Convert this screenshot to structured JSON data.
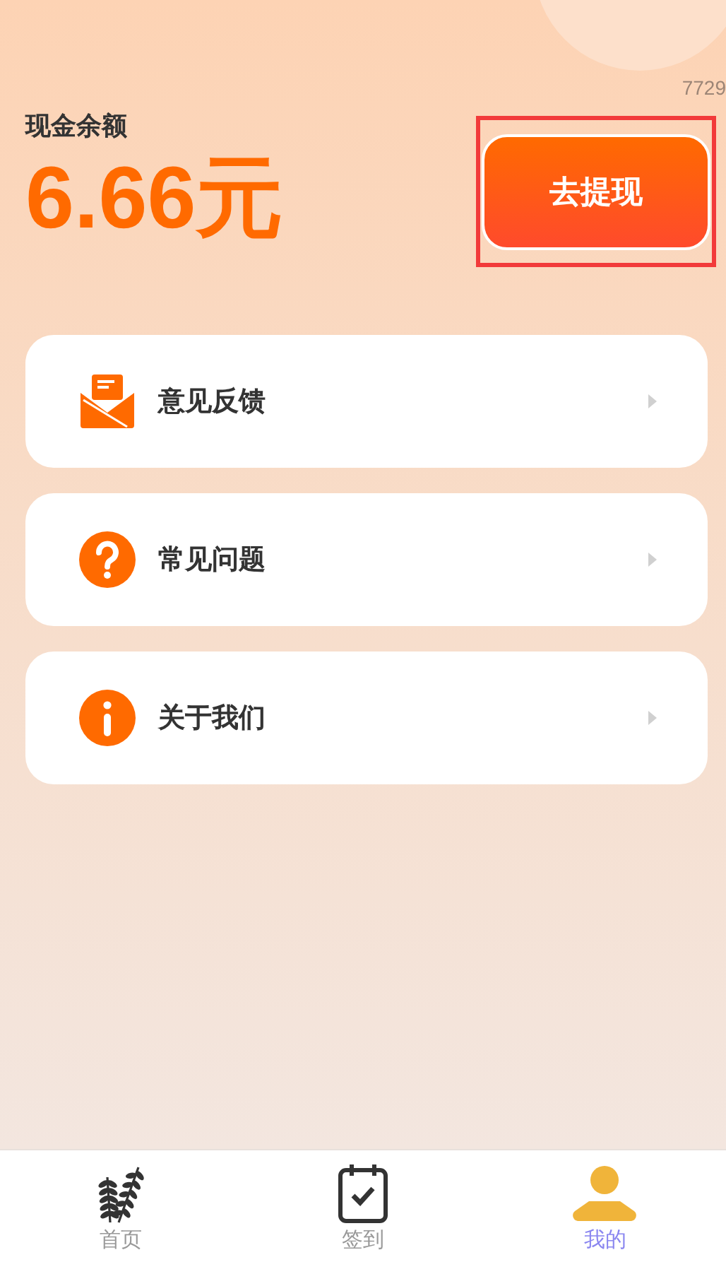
{
  "corner_code": "7729",
  "balance": {
    "label": "现金余额",
    "amount": "6.66元"
  },
  "withdraw_button": {
    "label": "去提现",
    "highlighted": true
  },
  "menu": [
    {
      "kind": "mail",
      "label": "意见反馈"
    },
    {
      "kind": "question",
      "label": "常见问题"
    },
    {
      "kind": "info",
      "label": "关于我们"
    }
  ],
  "tabs": [
    {
      "kind": "wheat",
      "label": "首页",
      "selected": false
    },
    {
      "kind": "calendar",
      "label": "签到",
      "selected": false
    },
    {
      "kind": "person",
      "label": "我的",
      "selected": true
    }
  ]
}
